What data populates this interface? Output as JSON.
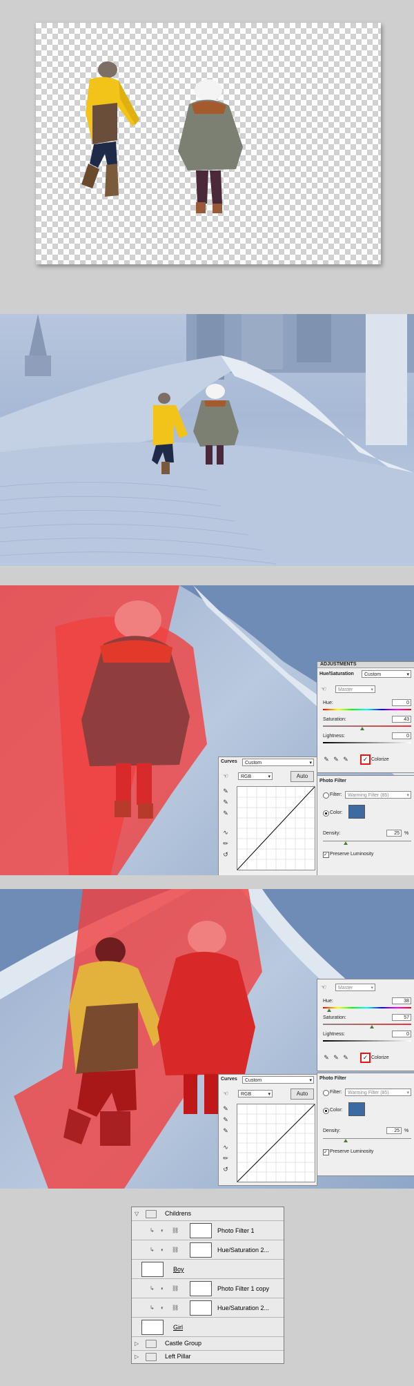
{
  "adjustments_panel": {
    "title": "ADJUSTMENTS",
    "hue_sat_label": "Hue/Saturation",
    "preset": "Custom",
    "channel": "Master",
    "hue_label": "Hue:",
    "hue_value": "0",
    "saturation_label": "Saturation:",
    "saturation_value": "43",
    "lightness_label": "Lightness:",
    "lightness_value": "0",
    "colorize_label": "Colorize"
  },
  "curves_panel_1": {
    "title": "Curves",
    "preset": "Custom",
    "channel": "RGB",
    "auto_label": "Auto"
  },
  "photo_filter_1": {
    "title": "Photo Filter",
    "filter_label": "Filter:",
    "filter_value": "Warming Filter (85)",
    "color_label": "Color:",
    "density_label": "Density:",
    "density_value": "25",
    "density_unit": "%",
    "preserve_label": "Preserve Luminosity",
    "swatch_color": "#3c6aa3"
  },
  "hue_sat_panel_2": {
    "channel": "Master",
    "hue_label": "Hue:",
    "hue_value": "38",
    "saturation_label": "Saturation:",
    "saturation_value": "57",
    "lightness_label": "Lightness:",
    "lightness_value": "0",
    "colorize_label": "Colorize"
  },
  "curves_panel_2": {
    "title": "Curves",
    "preset": "Custom",
    "channel": "RGB",
    "auto_label": "Auto"
  },
  "photo_filter_2": {
    "title": "Photo Filter",
    "filter_label": "Filter:",
    "filter_value": "Warming Filter (85)",
    "color_label": "Color:",
    "density_label": "Density:",
    "density_value": "25",
    "density_unit": "%",
    "preserve_label": "Preserve Luminosity",
    "swatch_color": "#3c6aa3"
  },
  "layers": [
    {
      "name": "Childrens",
      "kind": "group-open"
    },
    {
      "name": "Photo Filter 1",
      "kind": "adjustment"
    },
    {
      "name": "Hue/Saturation 2...",
      "kind": "adjustment"
    },
    {
      "name": "Boy",
      "kind": "pixel"
    },
    {
      "name": "Photo Filter 1 copy",
      "kind": "adjustment"
    },
    {
      "name": "Hue/Saturation 2...",
      "kind": "adjustment"
    },
    {
      "name": "Girl",
      "kind": "pixel"
    },
    {
      "name": "Castle Group",
      "kind": "group-closed"
    },
    {
      "name": "Left Pillar",
      "kind": "group-closed"
    }
  ],
  "colors": {
    "mask_red": "#f04040",
    "snow_blue": "#a9bcd8",
    "boy_jacket": "#f2c318"
  }
}
